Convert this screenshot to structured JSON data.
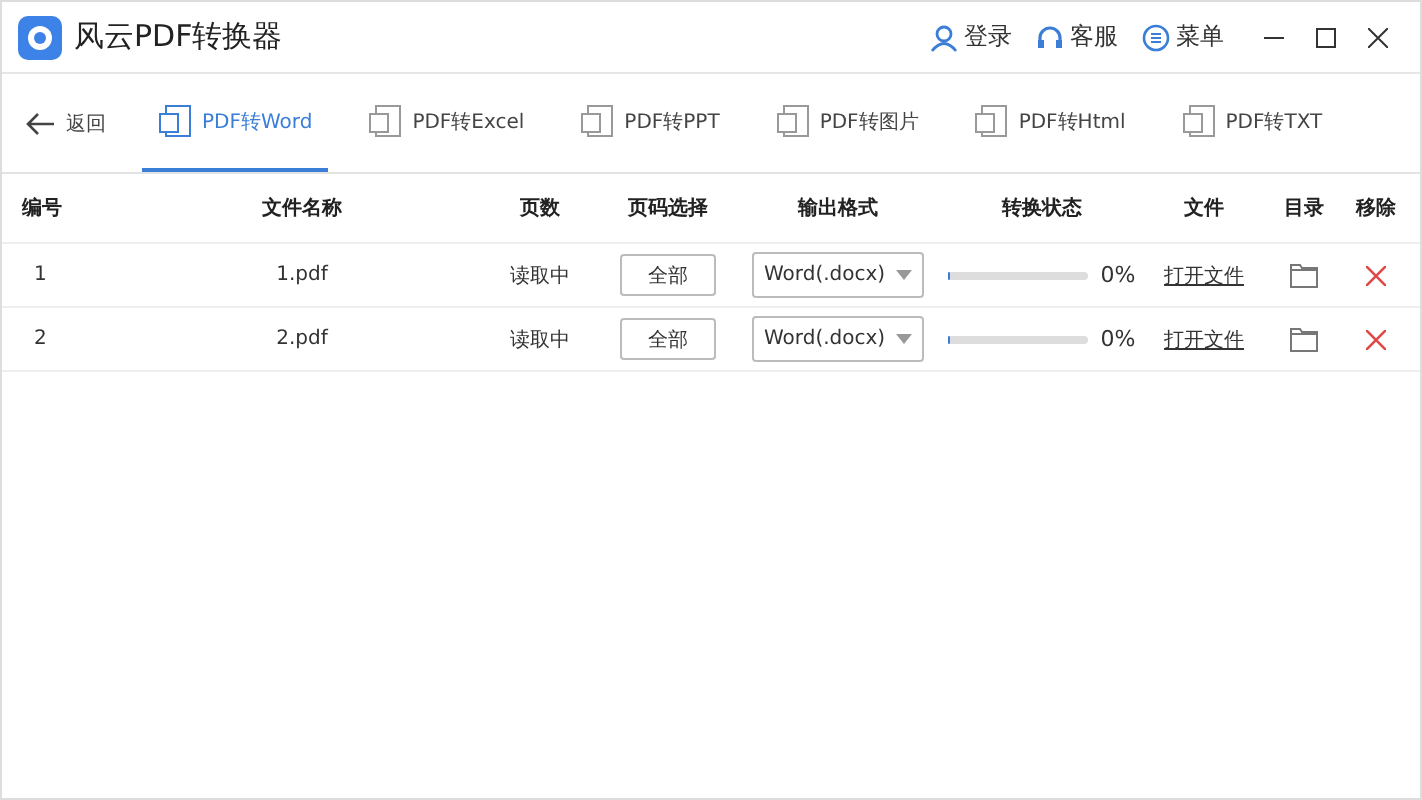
{
  "window": {
    "title": "风云PDF转换器",
    "actions": [
      {
        "kind": "user",
        "label": "登录"
      },
      {
        "kind": "headset",
        "label": "客服"
      },
      {
        "kind": "menu",
        "label": "菜单"
      }
    ]
  },
  "back": {
    "label": "返回"
  },
  "tabs": [
    {
      "label": "PDF转Word",
      "selected": true
    },
    {
      "label": "PDF转Excel",
      "selected": false
    },
    {
      "label": "PDF转PPT",
      "selected": false
    },
    {
      "label": "PDF转图片",
      "selected": false
    },
    {
      "label": "PDF转Html",
      "selected": false
    },
    {
      "label": "PDF转TXT",
      "selected": false
    }
  ],
  "table": {
    "columns": [
      "编号",
      "文件名称",
      "页数",
      "页码选择",
      "输出格式",
      "转换状态",
      "文件",
      "目录",
      "移除"
    ],
    "rows": [
      {
        "index": "1",
        "name": "1.pdf",
        "pages": "读取中",
        "page_select": "全部",
        "format": "Word(.docx)",
        "level": 0,
        "percent": "0%",
        "open": "打开文件"
      },
      {
        "index": "2",
        "name": "2.pdf",
        "pages": "读取中",
        "page_select": "全部",
        "format": "Word(.docx)",
        "level": 0,
        "percent": "0%",
        "open": "打开文件"
      }
    ]
  }
}
